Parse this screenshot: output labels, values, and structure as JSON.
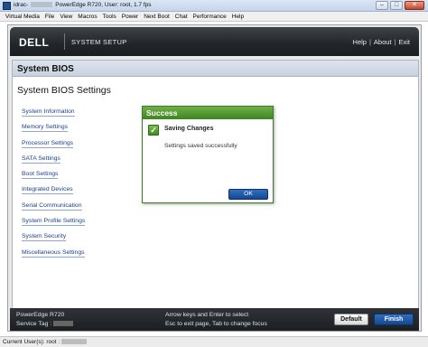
{
  "window": {
    "title_prefix": "idrac-",
    "title_suffix": "PowerEdge R720, User: root, 1.7 fps",
    "minimize": "–",
    "maximize": "□",
    "close": "✕"
  },
  "menubar": [
    "Virtual Media",
    "File",
    "View",
    "Macros",
    "Tools",
    "Power",
    "Next Boot",
    "Chat",
    "Performance",
    "Help"
  ],
  "header": {
    "logo": "DELL",
    "title": "SYSTEM SETUP",
    "links": [
      "Help",
      "About",
      "Exit"
    ],
    "separator": "|"
  },
  "panel": {
    "title": "System BIOS",
    "section_title": "System BIOS Settings",
    "links": [
      "System Information",
      "Memory Settings",
      "Processor Settings",
      "SATA Settings",
      "Boot Settings",
      "Integrated Devices",
      "Serial Communication",
      "System Profile Settings",
      "System Security",
      "Miscellaneous Settings"
    ]
  },
  "dialog": {
    "title": "Success",
    "icon": "checkmark-icon",
    "message_title": "Saving Changes",
    "message_text": "Settings saved successfully",
    "ok_label": "OK"
  },
  "footer": {
    "model": "PowerEdge R720",
    "service_tag_label": "Service Tag :",
    "help_line1": "Arrow keys and Enter to select",
    "help_line2": "Esc to exit page, Tab to change focus",
    "default_label": "Default",
    "finish_label": "Finish"
  },
  "status": {
    "text": "Current User(s): root :"
  },
  "colors": {
    "header_bg": "#22262a",
    "link": "#1a3f8b",
    "success_green": "#4f9a2e",
    "primary_button": "#1f5aa8"
  }
}
